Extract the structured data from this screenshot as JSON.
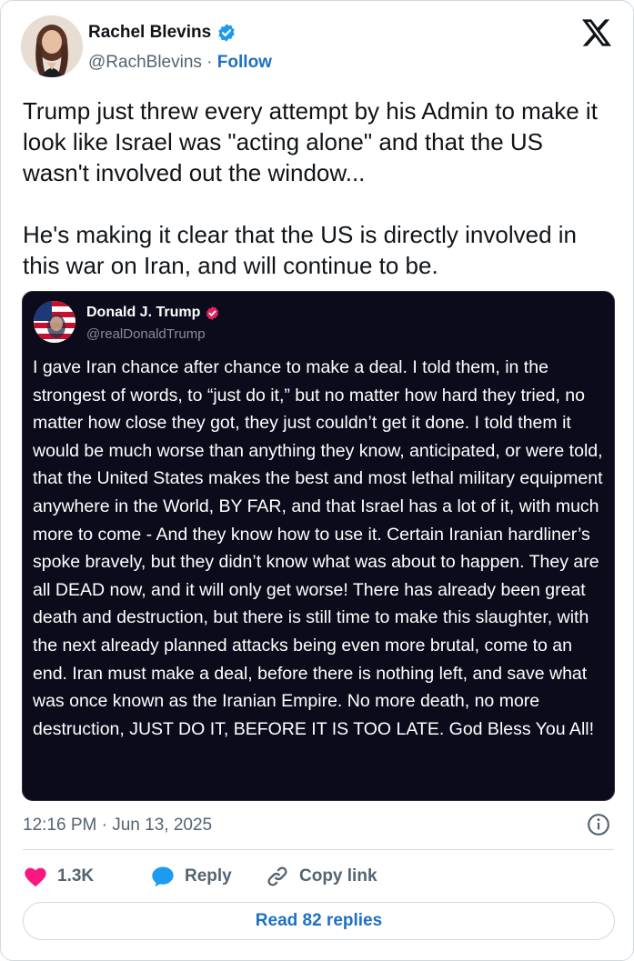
{
  "author": {
    "name": "Rachel Blevins",
    "handle": "@RachBlevins",
    "separator": "·",
    "follow_label": "Follow",
    "avatar_icon": "avatar-photo",
    "verified_icon": "verified-badge-icon",
    "verified_color": "#1d9bf0"
  },
  "logo_icon": "x-logo-icon",
  "tweet": {
    "text": "Trump just threw every attempt by his Admin to make it look like Israel was \"acting alone\" and that the US wasn't involved out the window...\n\nHe's making it clear that the US is directly involved in this war on Iran, and will continue to be."
  },
  "embedded_post": {
    "name": "Donald J. Trump",
    "handle": "@realDonaldTrump",
    "verified_icon": "verified-badge-icon",
    "verified_color": "#e0245e",
    "text": "I gave Iran chance after chance to make a deal. I told them, in the strongest of words, to “just do it,” but no matter how hard they tried, no matter how close they got, they just couldn’t get it done. I told them it would be much worse than anything they know, anticipated, or were told, that the United States makes the best and most lethal military equipment anywhere in the World, BY FAR, and that Israel has a lot of it, with much more to come - And they know how to use it. Certain Iranian hardliner’s spoke bravely, but they didn’t know what was about to happen. They are all DEAD now, and it will only get worse! There has already been great death and destruction, but there is still time to make this slaughter, with the next already planned attacks being even more brutal, come to an end. Iran must make a deal, before there is nothing left, and save what was once known as the Iranian Empire. No more death, no more destruction, JUST DO IT, BEFORE IT IS TOO LATE. God Bless You All!"
  },
  "timestamp": "12:16 PM · Jun 13, 2025",
  "info_icon": "info-icon",
  "actions": {
    "like_count": "1.3K",
    "like_icon": "heart-icon",
    "like_color": "#f91880",
    "reply_label": "Reply",
    "reply_icon": "reply-bubble-icon",
    "reply_color": "#1d9bf0",
    "copy_label": "Copy link",
    "copy_icon": "link-icon"
  },
  "read_replies_label": "Read 82 replies",
  "colors": {
    "accent": "#1d6fc4",
    "secondary_text": "#536471",
    "border": "#cfd9de",
    "embed_background": "#0b0b1c"
  }
}
